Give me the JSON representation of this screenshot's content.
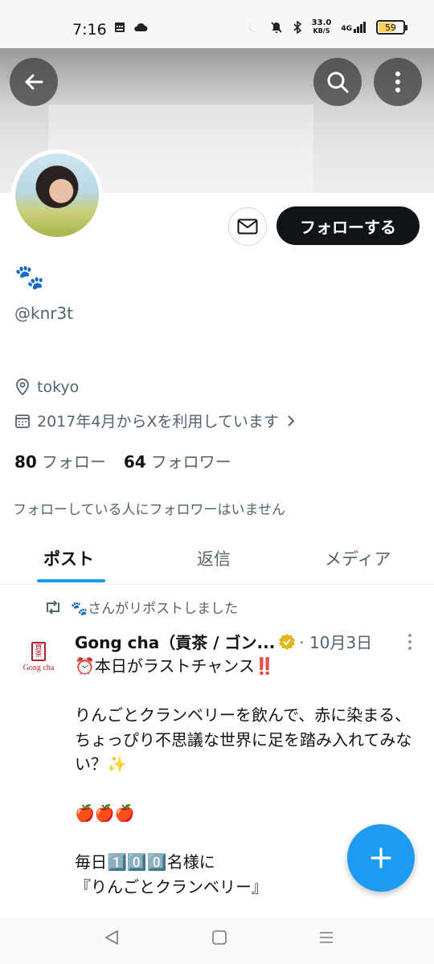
{
  "status_bar": {
    "time": "7:16",
    "net_speed_value": "33.0",
    "net_speed_unit": "KB/S",
    "signal_label": "4G",
    "battery_level": "59",
    "battery_fraction": 0.59
  },
  "header": {
    "back_icon": "arrow-left-icon",
    "search_icon": "search-icon",
    "more_icon": "more-vertical-icon"
  },
  "profile": {
    "display_name": "🐾",
    "handle": "@knr3t",
    "location": "tokyo",
    "joined": "2017年4月からXを利用しています",
    "following_count": "80",
    "following_label": "フォロー",
    "followers_count": "64",
    "followers_label": "フォロワー",
    "no_mutual_text": "フォローしている人にフォロワーはいません",
    "follow_button": "フォローする"
  },
  "tabs": [
    {
      "label": "ポスト",
      "active": true
    },
    {
      "label": "返信",
      "active": false
    },
    {
      "label": "メディア",
      "active": false
    }
  ],
  "post": {
    "repost_text": "🐾さんがリポストしました",
    "author_name": "Gong cha（貢茶 / ゴン...",
    "date": "· 10月3日",
    "avatar_seal": "貢茶",
    "avatar_text": "Gong cha",
    "body_lines": [
      "⏰本日がラストチャンス‼️",
      "",
      "りんごとクランベリーを飲んで、赤に染まる、",
      "ちょっぴり不思議な世界に足を踏み入れてみない？✨",
      "",
      "🍎🍎🍎",
      "",
      "毎日1️⃣0️⃣0️⃣名様に",
      "『りんごとクランベリー』"
    ]
  },
  "colors": {
    "accent": "#1d9bf0",
    "text_primary": "#0f1419",
    "text_secondary": "#536471"
  }
}
